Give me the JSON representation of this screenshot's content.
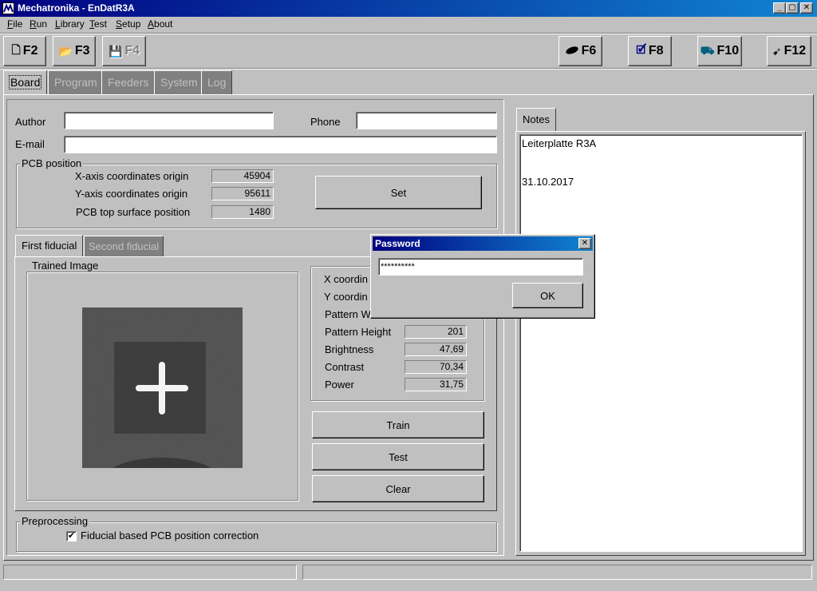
{
  "window": {
    "title": "Mechatronika - EnDatR3A",
    "controls": {
      "minimize": "_",
      "maximize": "▢",
      "close": "✕"
    }
  },
  "menu": [
    {
      "label": "File",
      "key": "F",
      "rest": "ile"
    },
    {
      "label": "Run",
      "key": "R",
      "rest": "un"
    },
    {
      "label": "Library",
      "key": "L",
      "rest": "ibrary"
    },
    {
      "label": "Test",
      "key": "T",
      "rest": "est"
    },
    {
      "label": "Setup",
      "key": "S",
      "rest": "etup"
    },
    {
      "label": "About",
      "key": "A",
      "rest": "bout"
    }
  ],
  "toolbar": {
    "f2": {
      "label": "F2",
      "icon": "new-file-icon"
    },
    "f3": {
      "label": "F3",
      "icon": "open-folder-icon"
    },
    "f4": {
      "label": "F4",
      "icon": "save-disk-icon"
    },
    "f6": {
      "label": "F6",
      "icon": "nozzle-icon"
    },
    "f8": {
      "label": "F8",
      "icon": "check-document-icon"
    },
    "f10": {
      "label": "F10",
      "icon": "machine-icon"
    },
    "f12": {
      "label": "F12",
      "icon": "run-arrow-icon"
    }
  },
  "tabs": [
    "Board",
    "Program",
    "Feeders",
    "System",
    "Log"
  ],
  "board": {
    "author_label": "Author",
    "author_value": "",
    "phone_label": "Phone",
    "phone_value": "",
    "email_label": "E-mail",
    "email_value": "",
    "pcb_position": {
      "title": "PCB position",
      "x_label": "X-axis coordinates origin",
      "x_value": "45904",
      "y_label": "Y-axis coordinates origin",
      "y_value": "95611",
      "top_label": "PCB top surface position",
      "top_value": "1480",
      "set_button": "Set"
    },
    "fiducial_tabs": [
      "First fiducial",
      "Second fiducial"
    ],
    "trained_image_title": "Trained Image",
    "params": {
      "x_label": "X coordin",
      "y_label": "Y coordin",
      "pw_label": "Pattern W",
      "ph_label": "Pattern Height",
      "ph_value": "201",
      "brightness_label": "Brightness",
      "brightness_value": "47,69",
      "contrast_label": "Contrast",
      "contrast_value": "70,34",
      "power_label": "Power",
      "power_value": "31,75"
    },
    "buttons": {
      "train": "Train",
      "test": "Test",
      "clear": "Clear"
    },
    "preprocessing": {
      "title": "Preprocessing",
      "checkbox_label": "Fiducial based PCB position correction",
      "checked": true,
      "check_mark": "✔"
    }
  },
  "notes": {
    "tab": "Notes",
    "line1": "Leiterplatte R3A",
    "line2": "31.10.2017"
  },
  "password_dialog": {
    "title": "Password",
    "value": "**********",
    "ok": "OK",
    "close": "✕"
  },
  "colors": {
    "title_start": "#000080",
    "title_end": "#1084d0",
    "face": "#c0c0c0"
  }
}
